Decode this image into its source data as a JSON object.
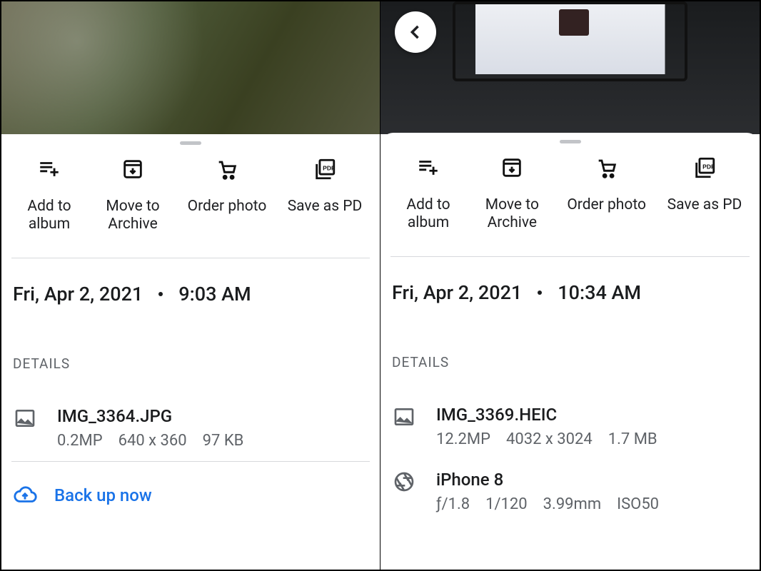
{
  "actions": {
    "add_to_album": "Add to\nalbum",
    "move_to_archive": "Move to\nArchive",
    "order_photo": "Order photo",
    "save_as_pdf": "Save as PD"
  },
  "details_heading": "DETAILS",
  "backup_label": "Back up now",
  "left": {
    "date": "Fri, Apr 2, 2021",
    "time": "9:03 AM",
    "file": {
      "name": "IMG_3364.JPG",
      "megapixels": "0.2MP",
      "dimensions": "640 x 360",
      "size": "97 KB"
    }
  },
  "right": {
    "date": "Fri, Apr 2, 2021",
    "time": "10:34 AM",
    "file": {
      "name": "IMG_3369.HEIC",
      "megapixels": "12.2MP",
      "dimensions": "4032 x 3024",
      "size": "1.7 MB"
    },
    "camera": {
      "model": "iPhone 8",
      "aperture": "ƒ/1.8",
      "shutter": "1/120",
      "focal": "3.99mm",
      "iso": "ISO50"
    }
  }
}
